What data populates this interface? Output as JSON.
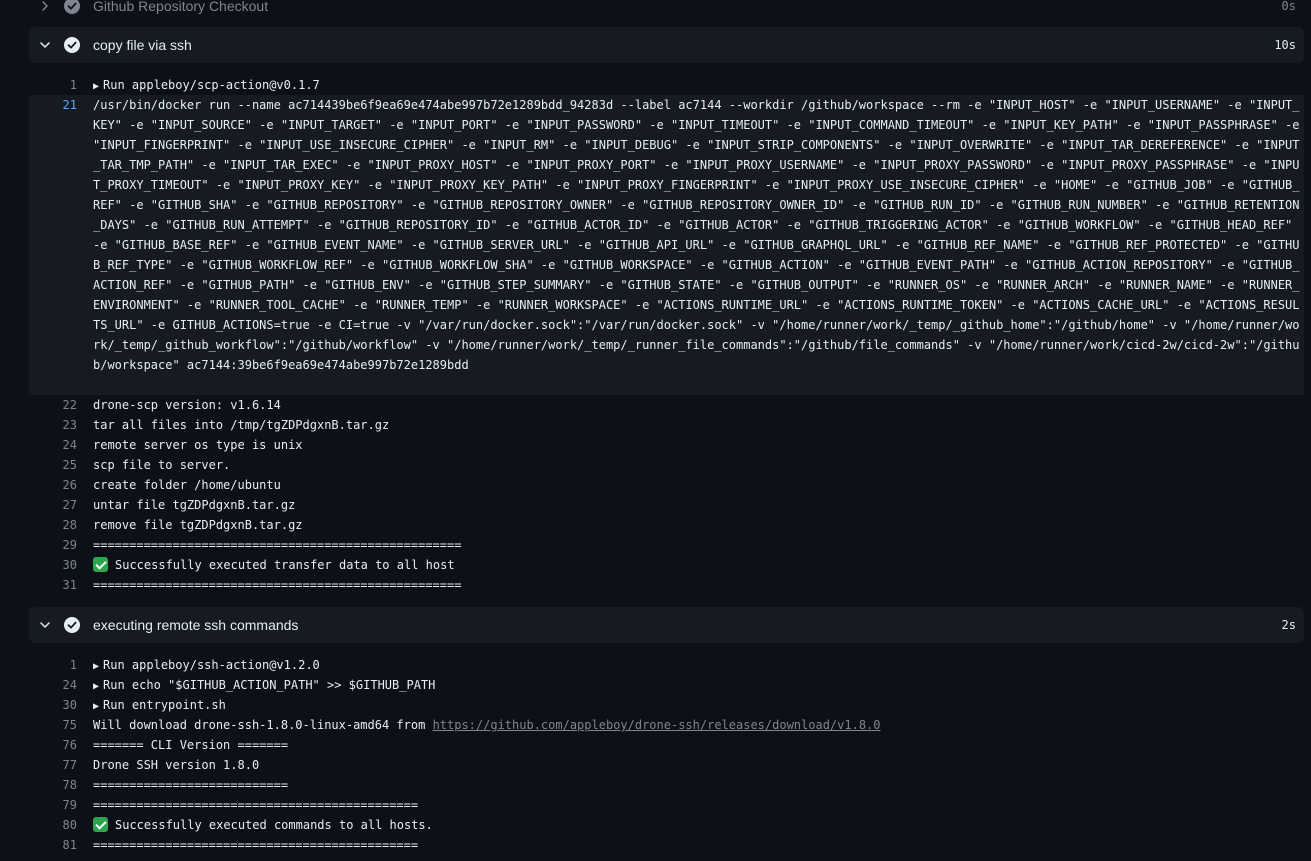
{
  "steps": {
    "checkout": {
      "title": "Github Repository Checkout",
      "duration": "0s"
    },
    "copy": {
      "title": "copy file via ssh",
      "duration": "10s"
    },
    "remote": {
      "title": "executing remote ssh commands",
      "duration": "2s"
    }
  },
  "copy_log": {
    "run_line": {
      "num": "1",
      "text": "Run appleboy/scp-action@v0.1.7"
    },
    "docker_line": {
      "num": "21",
      "text": "/usr/bin/docker run --name ac714439be6f9ea69e474abe997b72e1289bdd_94283d --label ac7144 --workdir /github/workspace --rm -e \"INPUT_HOST\" -e \"INPUT_USERNAME\" -e \"INPUT_KEY\" -e \"INPUT_SOURCE\" -e \"INPUT_TARGET\" -e \"INPUT_PORT\" -e \"INPUT_PASSWORD\" -e \"INPUT_TIMEOUT\" -e \"INPUT_COMMAND_TIMEOUT\" -e \"INPUT_KEY_PATH\" -e \"INPUT_PASSPHRASE\" -e \"INPUT_FINGERPRINT\" -e \"INPUT_USE_INSECURE_CIPHER\" -e \"INPUT_RM\" -e \"INPUT_DEBUG\" -e \"INPUT_STRIP_COMPONENTS\" -e \"INPUT_OVERWRITE\" -e \"INPUT_TAR_DEREFERENCE\" -e \"INPUT_TAR_TMP_PATH\" -e \"INPUT_TAR_EXEC\" -e \"INPUT_PROXY_HOST\" -e \"INPUT_PROXY_PORT\" -e \"INPUT_PROXY_USERNAME\" -e \"INPUT_PROXY_PASSWORD\" -e \"INPUT_PROXY_PASSPHRASE\" -e \"INPUT_PROXY_TIMEOUT\" -e \"INPUT_PROXY_KEY\" -e \"INPUT_PROXY_KEY_PATH\" -e \"INPUT_PROXY_FINGERPRINT\" -e \"INPUT_PROXY_USE_INSECURE_CIPHER\" -e \"HOME\" -e \"GITHUB_JOB\" -e \"GITHUB_REF\" -e \"GITHUB_SHA\" -e \"GITHUB_REPOSITORY\" -e \"GITHUB_REPOSITORY_OWNER\" -e \"GITHUB_REPOSITORY_OWNER_ID\" -e \"GITHUB_RUN_ID\" -e \"GITHUB_RUN_NUMBER\" -e \"GITHUB_RETENTION_DAYS\" -e \"GITHUB_RUN_ATTEMPT\" -e \"GITHUB_REPOSITORY_ID\" -e \"GITHUB_ACTOR_ID\" -e \"GITHUB_ACTOR\" -e \"GITHUB_TRIGGERING_ACTOR\" -e \"GITHUB_WORKFLOW\" -e \"GITHUB_HEAD_REF\" -e \"GITHUB_BASE_REF\" -e \"GITHUB_EVENT_NAME\" -e \"GITHUB_SERVER_URL\" -e \"GITHUB_API_URL\" -e \"GITHUB_GRAPHQL_URL\" -e \"GITHUB_REF_NAME\" -e \"GITHUB_REF_PROTECTED\" -e \"GITHUB_REF_TYPE\" -e \"GITHUB_WORKFLOW_REF\" -e \"GITHUB_WORKFLOW_SHA\" -e \"GITHUB_WORKSPACE\" -e \"GITHUB_ACTION\" -e \"GITHUB_EVENT_PATH\" -e \"GITHUB_ACTION_REPOSITORY\" -e \"GITHUB_ACTION_REF\" -e \"GITHUB_PATH\" -e \"GITHUB_ENV\" -e \"GITHUB_STEP_SUMMARY\" -e \"GITHUB_STATE\" -e \"GITHUB_OUTPUT\" -e \"RUNNER_OS\" -e \"RUNNER_ARCH\" -e \"RUNNER_NAME\" -e \"RUNNER_ENVIRONMENT\" -e \"RUNNER_TOOL_CACHE\" -e \"RUNNER_TEMP\" -e \"RUNNER_WORKSPACE\" -e \"ACTIONS_RUNTIME_URL\" -e \"ACTIONS_RUNTIME_TOKEN\" -e \"ACTIONS_CACHE_URL\" -e \"ACTIONS_RESULTS_URL\" -e GITHUB_ACTIONS=true -e CI=true -v \"/var/run/docker.sock\":\"/var/run/docker.sock\" -v \"/home/runner/work/_temp/_github_home\":\"/github/home\" -v \"/home/runner/work/_temp/_github_workflow\":\"/github/workflow\" -v \"/home/runner/work/_temp/_runner_file_commands\":\"/github/file_commands\" -v \"/home/runner/work/cicd-2w/cicd-2w\":\"/github/workspace\" ac7144:39be6f9ea69e474abe997b72e1289bdd"
    },
    "lines": [
      {
        "num": "22",
        "text": "drone-scp version: v1.6.14"
      },
      {
        "num": "23",
        "text": "tar all files into /tmp/tgZDPdgxnB.tar.gz"
      },
      {
        "num": "24",
        "text": "remote server os type is unix"
      },
      {
        "num": "25",
        "text": "scp file to server."
      },
      {
        "num": "26",
        "text": "create folder /home/ubuntu"
      },
      {
        "num": "27",
        "text": "untar file tgZDPdgxnB.tar.gz"
      },
      {
        "num": "28",
        "text": "remove file tgZDPdgxnB.tar.gz"
      },
      {
        "num": "29",
        "text": "==================================================="
      },
      {
        "num": "30",
        "text": "Successfully executed transfer data to all host"
      },
      {
        "num": "31",
        "text": "==================================================="
      }
    ]
  },
  "remote_log": {
    "lines": [
      {
        "num": "1",
        "text": "Run appleboy/ssh-action@v1.2.0"
      },
      {
        "num": "24",
        "text": "Run echo \"$GITHUB_ACTION_PATH\" >> $GITHUB_PATH"
      },
      {
        "num": "30",
        "text": "Run entrypoint.sh"
      },
      {
        "num": "75",
        "text": "Will download drone-ssh-1.8.0-linux-amd64 from "
      },
      {
        "num": "76",
        "text": "======= CLI Version ======="
      },
      {
        "num": "77",
        "text": "Drone SSH version 1.8.0"
      },
      {
        "num": "78",
        "text": "==========================="
      },
      {
        "num": "79",
        "text": "============================================="
      },
      {
        "num": "80",
        "text": "Successfully executed commands to all hosts."
      },
      {
        "num": "81",
        "text": "============================================="
      }
    ],
    "download_url": "https://github.com/appleboy/drone-ssh/releases/download/v1.8.0"
  },
  "colors": {
    "background": "#0d1117",
    "header_bg": "#161b22",
    "line_number": "#7d8590",
    "active_line_number": "#58a6ff",
    "success": "#2da44e"
  },
  "icons": {
    "chevron_collapsed": "chevron-right-icon",
    "chevron_expanded": "chevron-down-icon",
    "status": "check-circle-icon",
    "run_toggle": "triangle-right-icon",
    "success_emoji": "white-check-mark-icon"
  }
}
